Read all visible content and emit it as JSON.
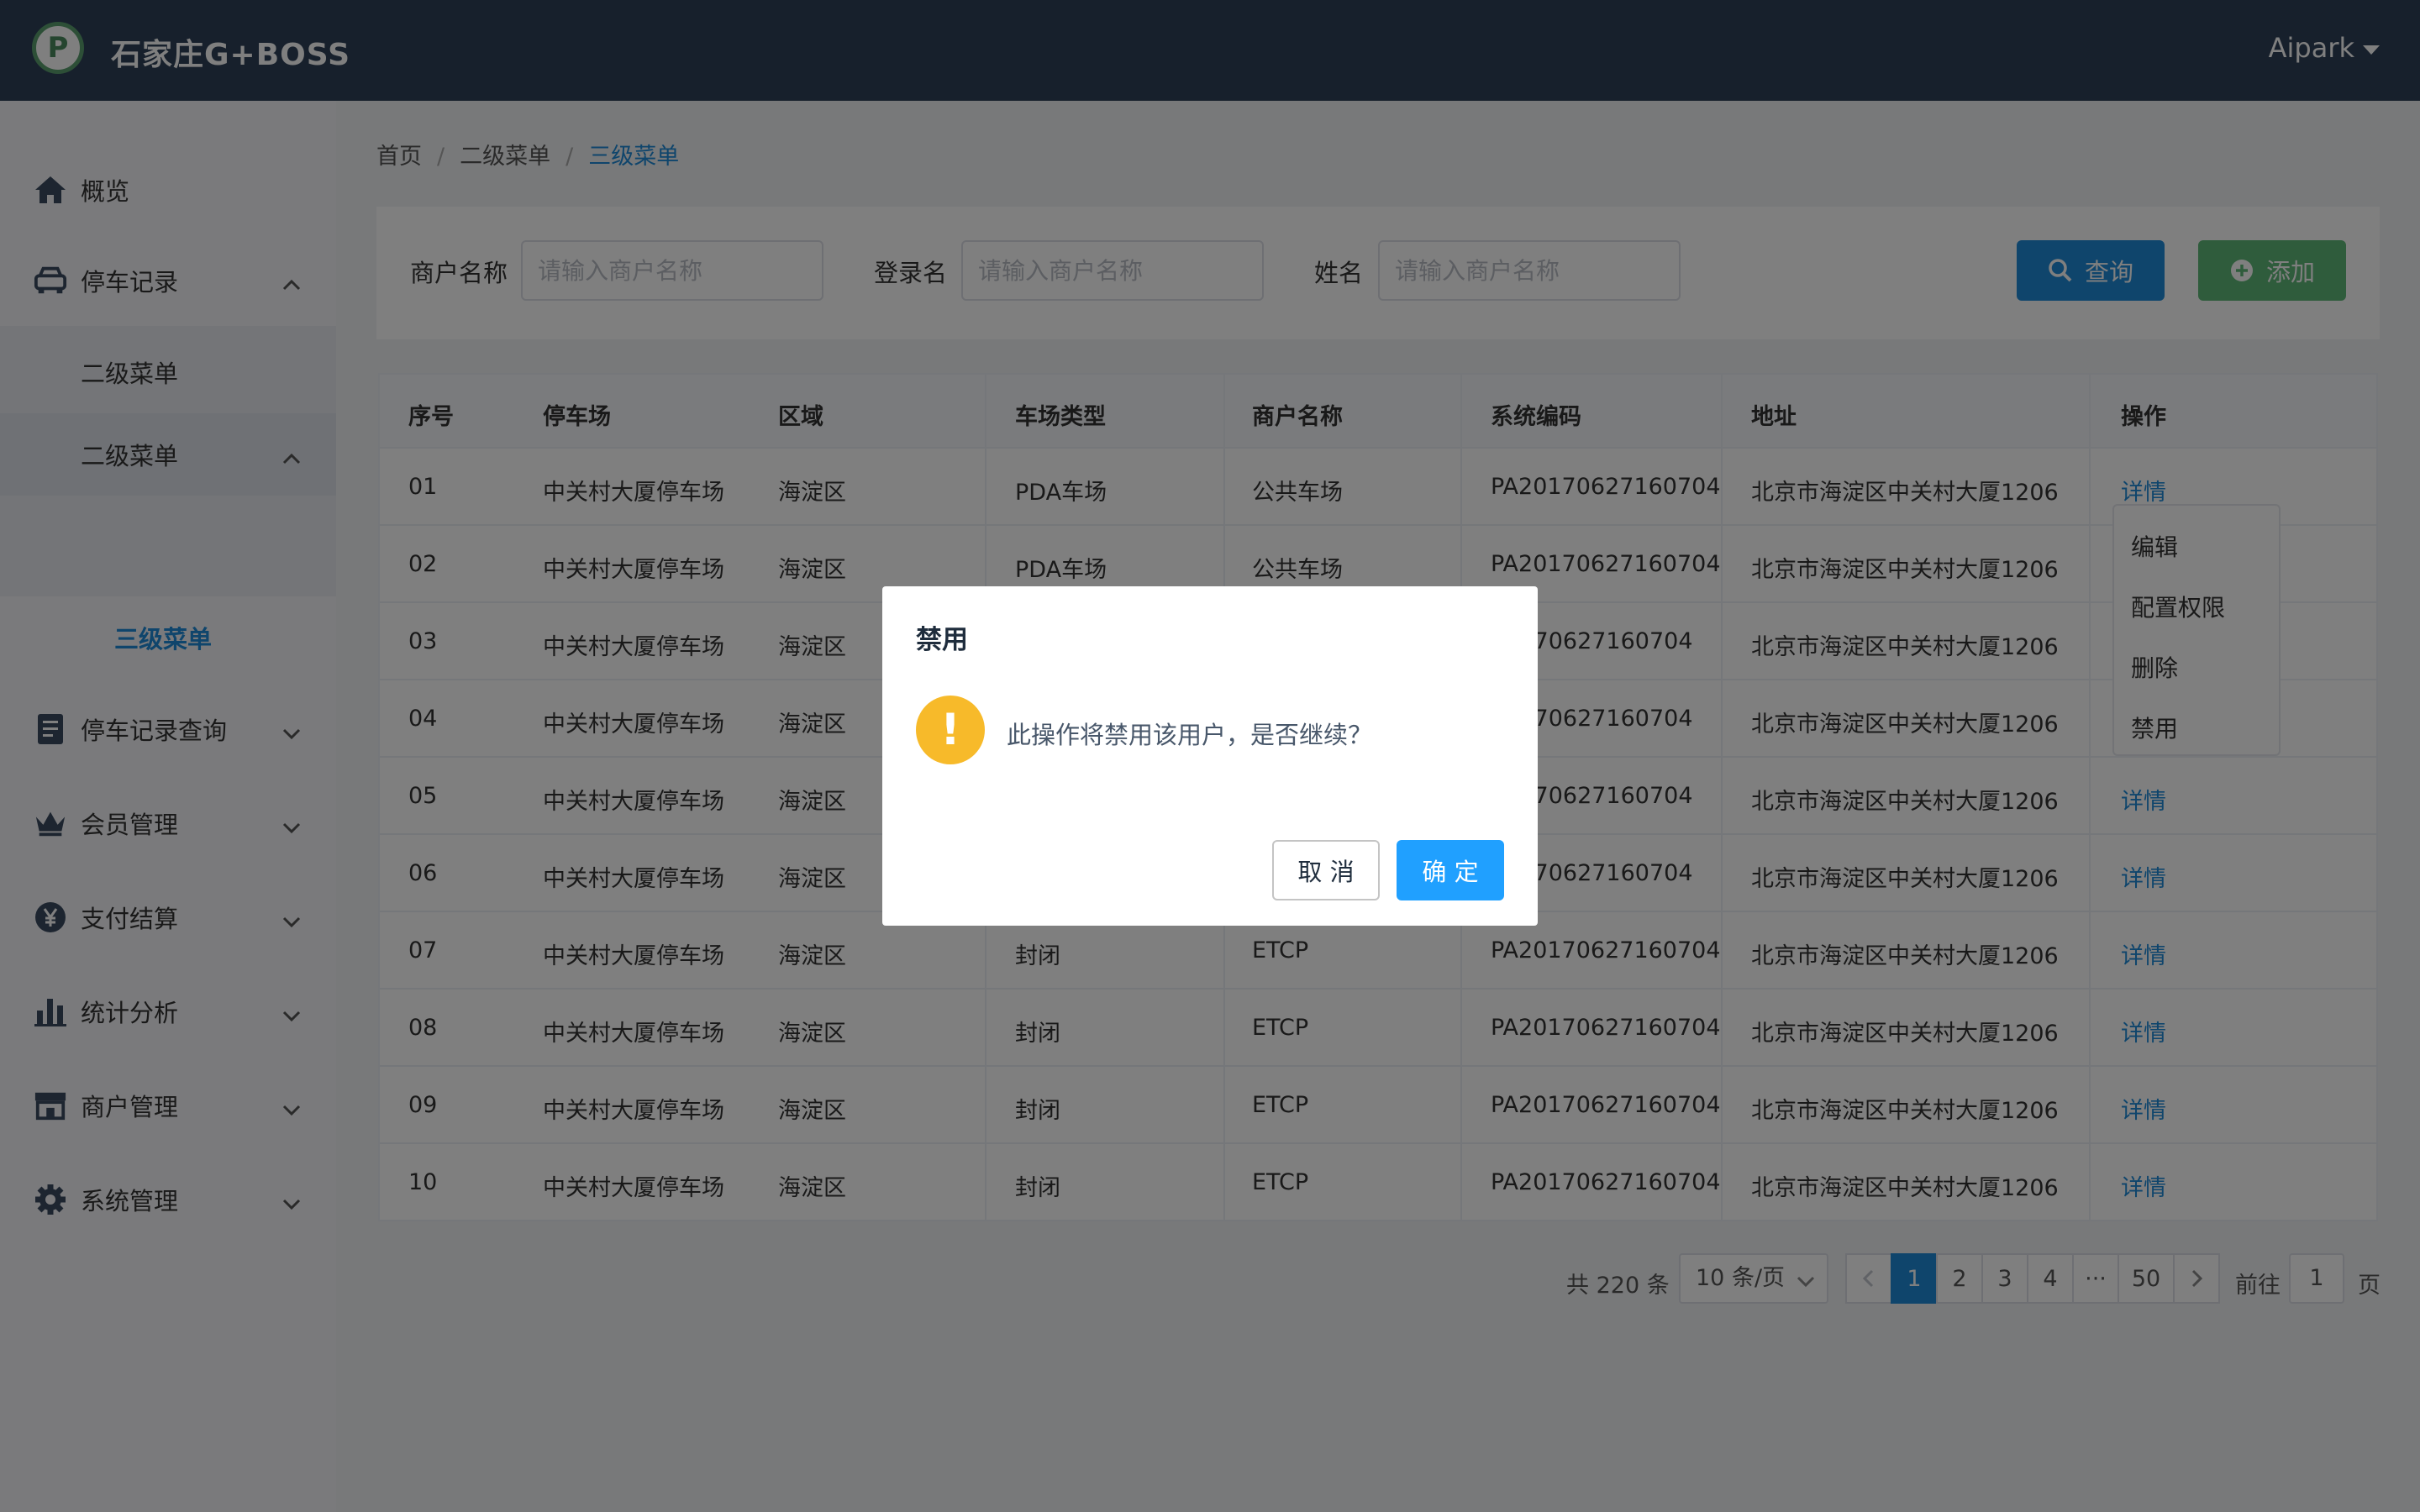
{
  "app": {
    "title": "石家庄G+BOSS",
    "logo_letter": "P",
    "user": "Aipark"
  },
  "sidebar": {
    "items": [
      {
        "label": "概览",
        "icon": "home-icon"
      },
      {
        "label": "停车记录",
        "icon": "car-icon",
        "expanded": true
      },
      {
        "label": "停车记录查询",
        "icon": "document-icon"
      },
      {
        "label": "会员管理",
        "icon": "crown-icon"
      },
      {
        "label": "支付结算",
        "icon": "yen-icon"
      },
      {
        "label": "统计分析",
        "icon": "bar-chart-icon"
      },
      {
        "label": "商户管理",
        "icon": "store-icon"
      },
      {
        "label": "系统管理",
        "icon": "gear-icon"
      }
    ],
    "sub_items": [
      "二级菜单",
      "二级菜单"
    ],
    "sub_sub_item": "三级菜单"
  },
  "breadcrumb": [
    "首页",
    "二级菜单",
    "三级菜单"
  ],
  "filters": [
    {
      "label": "商户名称",
      "placeholder": "请输入商户名称"
    },
    {
      "label": "登录名",
      "placeholder": "请输入商户名称"
    },
    {
      "label": "姓名",
      "placeholder": "请输入商户名称"
    }
  ],
  "buttons": {
    "query": "查询",
    "add": "添加"
  },
  "table": {
    "headers": [
      "序号",
      "停车场",
      "区域",
      "车场类型",
      "商户名称",
      "系统编码",
      "地址",
      "操作"
    ],
    "rows": [
      [
        "01",
        "中关村大厦停车场",
        "海淀区",
        "PDA车场",
        "公共车场",
        "PA20170627160704",
        "北京市海淀区中关村大厦1206",
        "详情"
      ],
      [
        "02",
        "中关村大厦停车场",
        "海淀区",
        "PDA车场",
        "公共车场",
        "PA20170627160704",
        "北京市海淀区中关村大厦1206",
        ""
      ],
      [
        "03",
        "中关村大厦停车场",
        "海淀区",
        "",
        "",
        "20170627160704",
        "北京市海淀区中关村大厦1206",
        ""
      ],
      [
        "04",
        "中关村大厦停车场",
        "海淀区",
        "",
        "",
        "20170627160704",
        "北京市海淀区中关村大厦1206",
        ""
      ],
      [
        "05",
        "中关村大厦停车场",
        "海淀区",
        "",
        "",
        "20170627160704",
        "北京市海淀区中关村大厦1206",
        "详情"
      ],
      [
        "06",
        "中关村大厦停车场",
        "海淀区",
        "",
        "",
        "20170627160704",
        "北京市海淀区中关村大厦1206",
        "详情"
      ],
      [
        "07",
        "中关村大厦停车场",
        "海淀区",
        "封闭",
        "ETCP",
        "PA20170627160704",
        "北京市海淀区中关村大厦1206",
        "详情"
      ],
      [
        "08",
        "中关村大厦停车场",
        "海淀区",
        "封闭",
        "ETCP",
        "PA20170627160704",
        "北京市海淀区中关村大厦1206",
        "详情"
      ],
      [
        "09",
        "中关村大厦停车场",
        "海淀区",
        "封闭",
        "ETCP",
        "PA20170627160704",
        "北京市海淀区中关村大厦1206",
        "详情"
      ],
      [
        "10",
        "中关村大厦停车场",
        "海淀区",
        "封闭",
        "ETCP",
        "PA20170627160704",
        "北京市海淀区中关村大厦1206",
        "详情"
      ]
    ]
  },
  "dropdown_menu": [
    "编辑",
    "配置权限",
    "删除",
    "禁用"
  ],
  "pagination": {
    "total": "共 220 条",
    "page_size": "10 条/页",
    "pages": [
      "1",
      "2",
      "3",
      "4",
      "···",
      "50"
    ],
    "current": "1",
    "goto_prefix": "前往",
    "goto_value": "1",
    "goto_suffix": "页"
  },
  "dialog": {
    "title": "禁用",
    "message": "此操作将禁用该用户，是否继续？",
    "icon": "warning-icon",
    "cancel": "取 消",
    "confirm": "确 定"
  },
  "colors": {
    "header": "#2f4159",
    "primary": "#1f8bd8",
    "dialog_confirm": "#20a0ff",
    "add_button": "#5fb878",
    "warning": "#f7ba2a"
  }
}
